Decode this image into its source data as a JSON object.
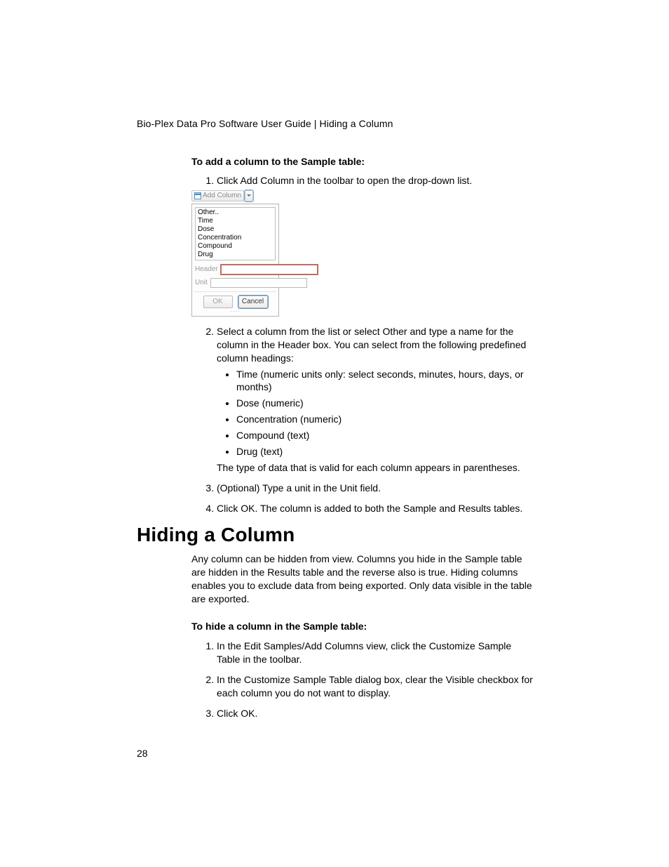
{
  "header": {
    "breadcrumb": "Bio-Plex Data Pro Software User Guide | Hiding a Column"
  },
  "section1": {
    "subhead": "To add a column to the Sample table:",
    "step1": "Click Add Column in the toolbar to open the drop-down list.",
    "dropdown": {
      "button_label": "Add Column",
      "options": [
        "Other..",
        "Time",
        "Dose",
        "Concentration",
        "Compound",
        "Drug"
      ],
      "header_label": "Header",
      "header_value": "",
      "unit_label": "Unit",
      "unit_value": "",
      "ok_label": "OK",
      "cancel_label": "Cancel"
    },
    "step2_intro": "Select a column from the list or select Other and type a name for the column in the Header box. You can select from the following predefined column headings:",
    "step2_bullets": [
      "Time (numeric units only: select seconds, minutes, hours, days, or months)",
      "Dose (numeric)",
      "Concentration (numeric)",
      "Compound (text)",
      "Drug (text)"
    ],
    "step2_trailer": "The type of data that is valid for each column appears in parentheses.",
    "step3": "(Optional) Type a unit in the Unit field.",
    "step4": "Click OK. The column is added to both the Sample and Results tables."
  },
  "section2": {
    "heading": "Hiding a Column",
    "para": "Any column can be hidden from view. Columns you hide in the Sample table are hidden in the Results table and the reverse also is true. Hiding columns enables you to exclude data from being exported. Only data visible in the table are exported.",
    "subhead": "To hide a column in the Sample table:",
    "step1": "In the Edit Samples/Add Columns view, click the Customize Sample Table in the toolbar.",
    "step2": "In the Customize Sample Table dialog box, clear the Visible checkbox for each column you do not want to display.",
    "step3": "Click OK."
  },
  "footer": {
    "page_number": "28"
  }
}
